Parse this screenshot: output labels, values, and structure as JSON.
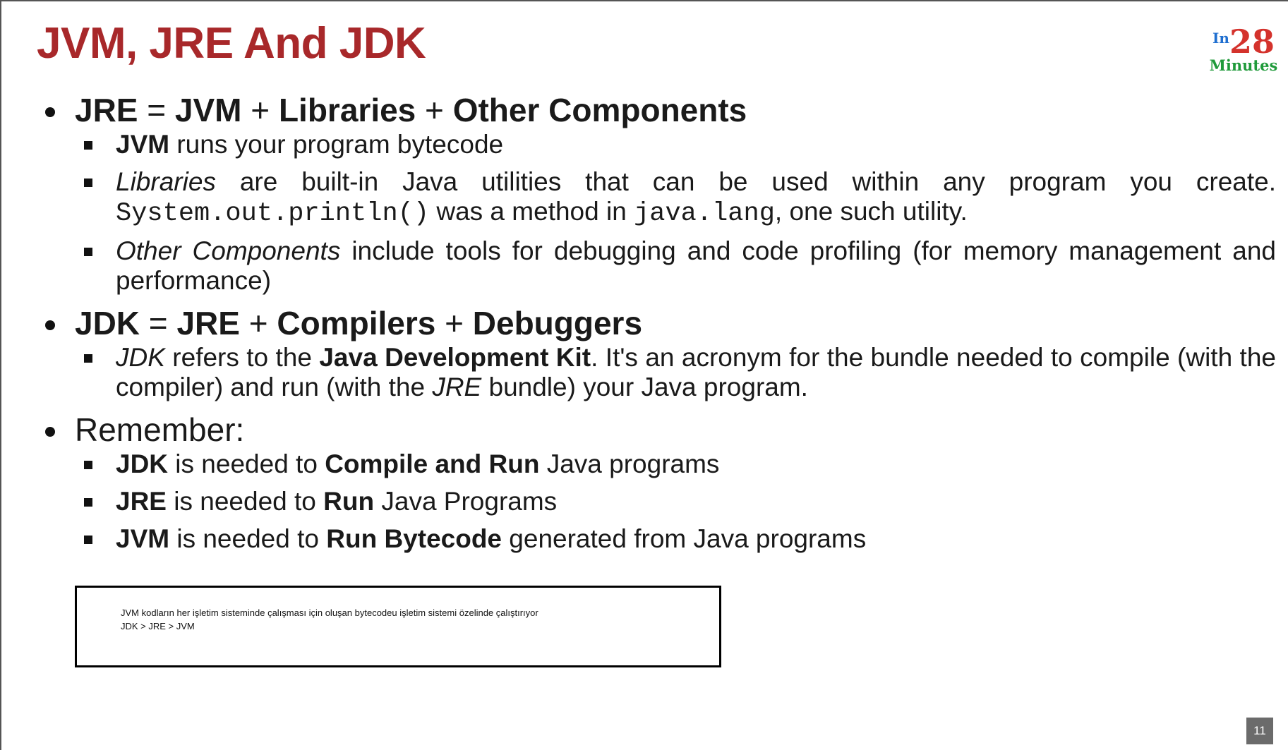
{
  "title": "JVM, JRE And JDK",
  "logo": {
    "prefix": "In",
    "number": "28",
    "word": "Minutes"
  },
  "sections": [
    {
      "heading": {
        "a": "JRE",
        "eq": " = ",
        "b": "JVM",
        "p1": " + ",
        "c": "Libraries",
        "p2": " + ",
        "d": "Other Components"
      },
      "items": [
        {
          "bold": "JVM",
          "text": " runs your program bytecode"
        },
        {
          "italic": "Libraries",
          "text1": " are built-in Java utilities that can be used within any program you create. ",
          "code1": "System.out.println()",
          "text2": " was a method in ",
          "code2": "java.lang",
          "text3": ", one such utility."
        },
        {
          "italic": "Other Components",
          "text": " include tools for debugging and code profiling (for memory management and performance)"
        }
      ]
    },
    {
      "heading": {
        "a": "JDK",
        "eq": " = ",
        "b": "JRE",
        "p1": " + ",
        "c": "Compilers",
        "p2": " + ",
        "d": "Debuggers"
      },
      "items": [
        {
          "italic": "JDK",
          "text1": " refers to the ",
          "bold": "Java Development Kit",
          "text2": ". It's an acronym for the bundle needed to compile (with the compiler) and run (with the ",
          "italic2": "JRE",
          "text3": " bundle) your Java program."
        }
      ]
    },
    {
      "heading": {
        "text": "Remember:"
      },
      "items": [
        {
          "bold1": "JDK",
          "text1": " is needed to ",
          "bold2": "Compile and Run",
          "text2": " Java programs"
        },
        {
          "bold1": "JRE",
          "text1": " is needed to ",
          "bold2": "Run",
          "text2": " Java Programs"
        },
        {
          "bold1": "JVM",
          "text1": " is needed to ",
          "bold2": "Run Bytecode",
          "text2": " generated from Java programs"
        }
      ]
    }
  ],
  "note": {
    "line1": "JVM kodların her işletim sisteminde çalışması için oluşan bytecodeu işletim sistemi özelinde çalıştırıyor",
    "line2": "JDK > JRE > JVM"
  },
  "page_number": "11"
}
